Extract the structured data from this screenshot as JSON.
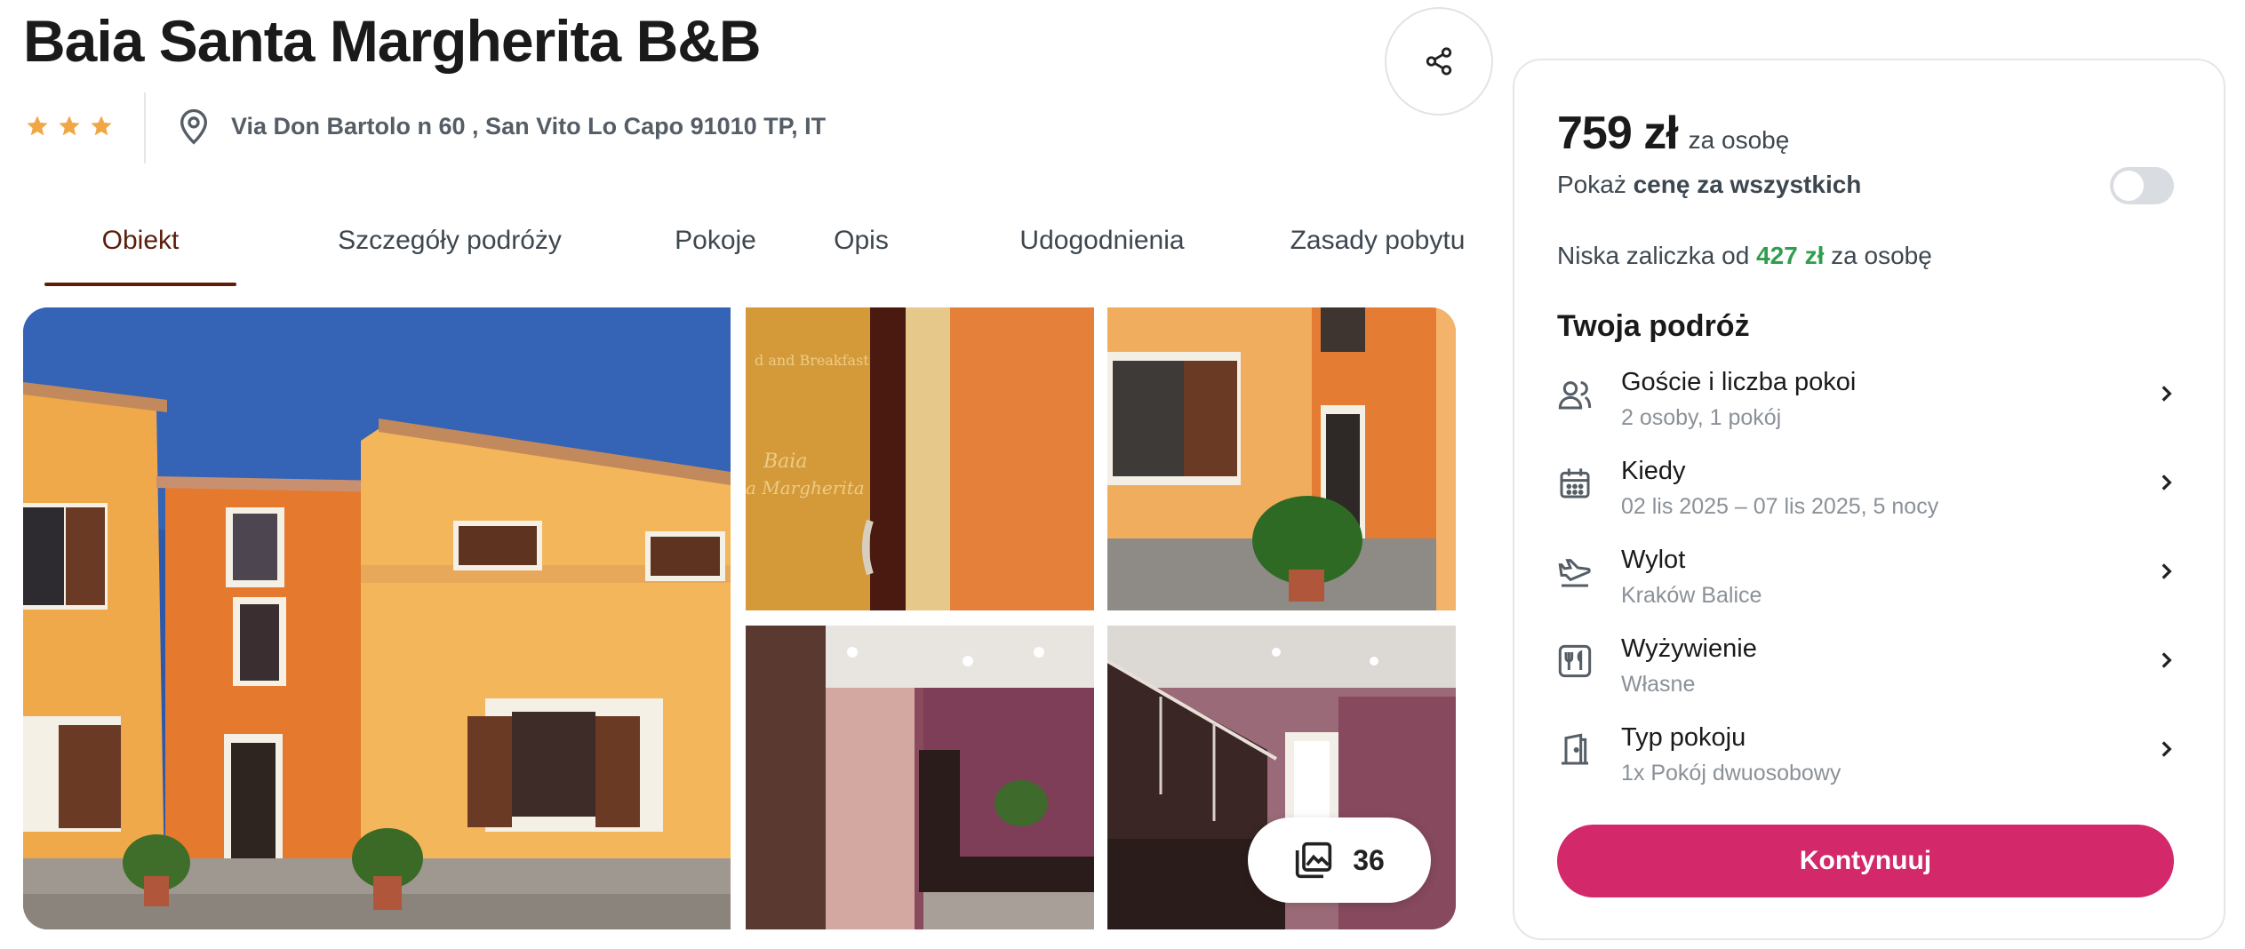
{
  "header": {
    "title": "Baia Santa Margherita B&B",
    "address": "Via Don Bartolo n 60 , San Vito Lo Capo 91010 TP, IT",
    "rating_stars": 3
  },
  "tabs": [
    {
      "label": "Obiekt",
      "active": true
    },
    {
      "label": "Szczegóły podróży",
      "active": false
    },
    {
      "label": "Pokoje",
      "active": false
    },
    {
      "label": "Opis",
      "active": false
    },
    {
      "label": "Udogodnienia",
      "active": false
    },
    {
      "label": "Zasady pobytu",
      "active": false
    }
  ],
  "gallery": {
    "photo_count": "36"
  },
  "booking": {
    "price": "759 zł",
    "price_unit": "za osobę",
    "toggle_prefix": "Pokaż",
    "toggle_bold": "cenę za wszystkich",
    "toggle_on": false,
    "deposit_prefix": "Niska zaliczka od",
    "deposit_amount": "427 zł",
    "deposit_suffix": "za osobę",
    "section_title": "Twoja podróż",
    "rows": [
      {
        "label": "Goście i liczba pokoi",
        "value": "2 osoby, 1 pokój",
        "icon": "guests-icon"
      },
      {
        "label": "Kiedy",
        "value": "02 lis 2025 – 07 lis 2025, 5 nocy",
        "icon": "calendar-icon"
      },
      {
        "label": "Wylot",
        "value": "Kraków Balice",
        "icon": "plane-departure-icon"
      },
      {
        "label": "Wyżywienie",
        "value": "Własne",
        "icon": "meal-icon"
      },
      {
        "label": "Typ pokoju",
        "value": "1x Pokój dwuosobowy",
        "icon": "room-door-icon"
      }
    ],
    "continue_label": "Kontynuuj"
  },
  "colors": {
    "accent": "#d3286a",
    "active_tab": "#5a1e0b",
    "deposit_green": "#2f9e4e",
    "star": "#f0a844"
  }
}
